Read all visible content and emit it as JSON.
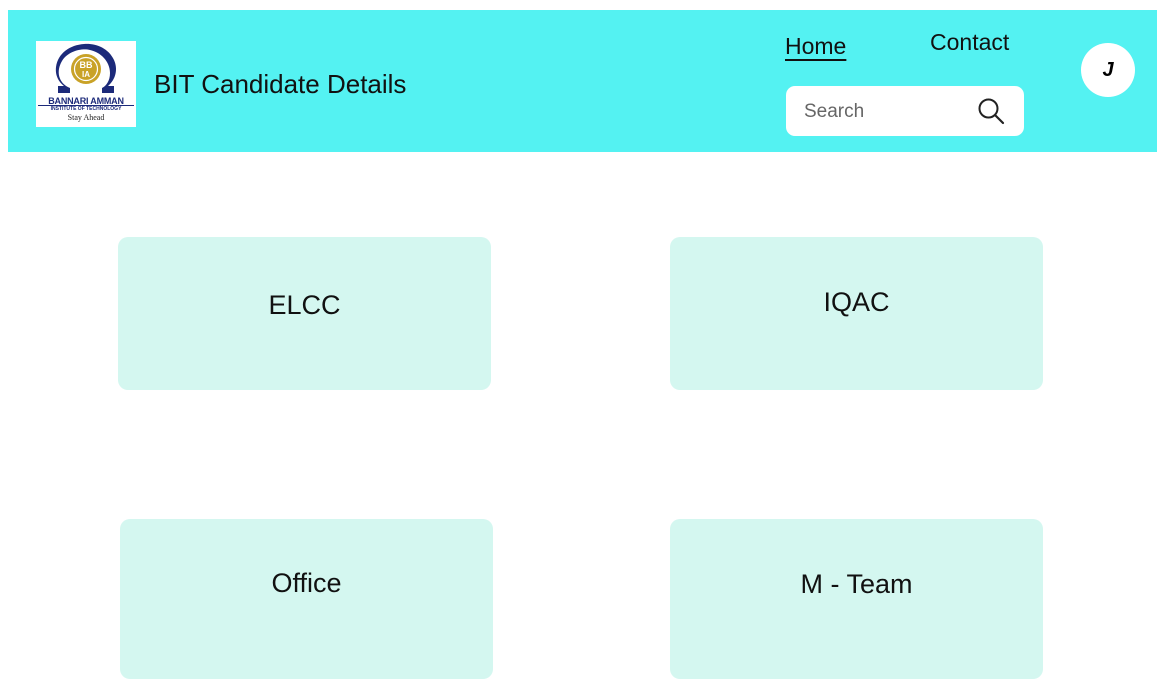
{
  "header": {
    "logo": {
      "name": "BANNARI AMMAN",
      "subtitle": "INSTITUTE OF TECHNOLOGY",
      "tagline": "Stay Ahead"
    },
    "title": "BIT Candidate Details",
    "nav": {
      "home": "Home",
      "contact": "Contact"
    },
    "search": {
      "placeholder": "Search",
      "icon": "search-icon"
    },
    "avatar_initial": "J"
  },
  "cards": [
    {
      "label": "ELCC"
    },
    {
      "label": "IQAC"
    },
    {
      "label": "Office"
    },
    {
      "label": "M - Team"
    }
  ],
  "colors": {
    "header_bg": "#54f2f2",
    "card_bg": "#d4f7f0",
    "logo_blue": "#1c2a7a",
    "logo_gold": "#c9a227"
  }
}
